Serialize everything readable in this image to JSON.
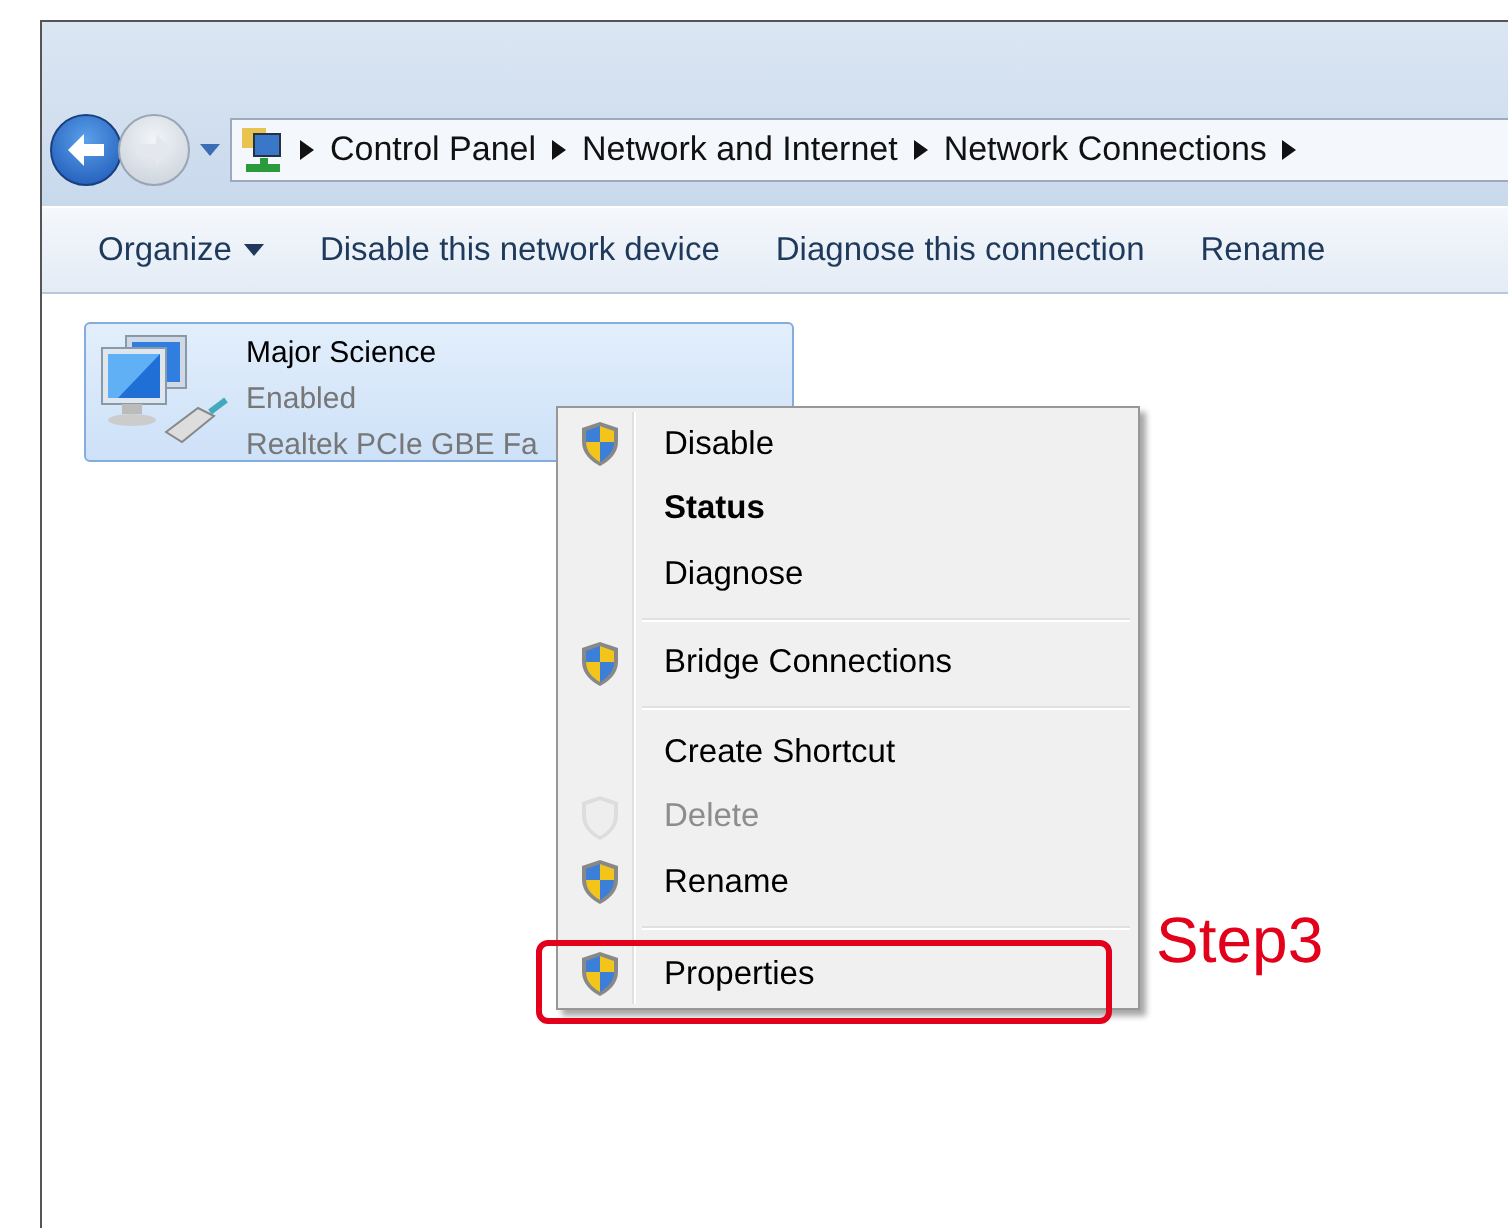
{
  "breadcrumb": [
    {
      "label": "Control Panel"
    },
    {
      "label": "Network and Internet"
    },
    {
      "label": "Network Connections"
    }
  ],
  "toolbar": [
    {
      "label": "Organize",
      "dropdown": true
    },
    {
      "label": "Disable this network device",
      "dropdown": false
    },
    {
      "label": "Diagnose this connection",
      "dropdown": false
    },
    {
      "label": "Rename",
      "dropdown": false
    }
  ],
  "connection": {
    "name": "Major Science",
    "status": "Enabled",
    "adapter": "Realtek PCIe GBE Fa",
    "selected": true
  },
  "context_menu": [
    [
      {
        "label": "Disable",
        "kind": "shield",
        "disabled": false,
        "default": false,
        "selected": false
      },
      {
        "label": "Status",
        "kind": "plain",
        "disabled": false,
        "default": true,
        "selected": false
      },
      {
        "label": "Diagnose",
        "kind": "plain",
        "disabled": false,
        "default": false,
        "selected": false
      }
    ],
    [
      {
        "label": "Bridge Connections",
        "kind": "shield",
        "disabled": false,
        "default": false,
        "selected": false
      }
    ],
    [
      {
        "label": "Create Shortcut",
        "kind": "plain",
        "disabled": false,
        "default": false,
        "selected": false
      },
      {
        "label": "Delete",
        "kind": "shield",
        "disabled": true,
        "default": false,
        "selected": false
      },
      {
        "label": "Rename",
        "kind": "shield",
        "disabled": false,
        "default": false,
        "selected": false
      }
    ],
    [
      {
        "label": "Properties",
        "kind": "shield",
        "disabled": false,
        "default": false,
        "selected": true
      }
    ]
  ],
  "annotation": {
    "label": "Step3"
  }
}
